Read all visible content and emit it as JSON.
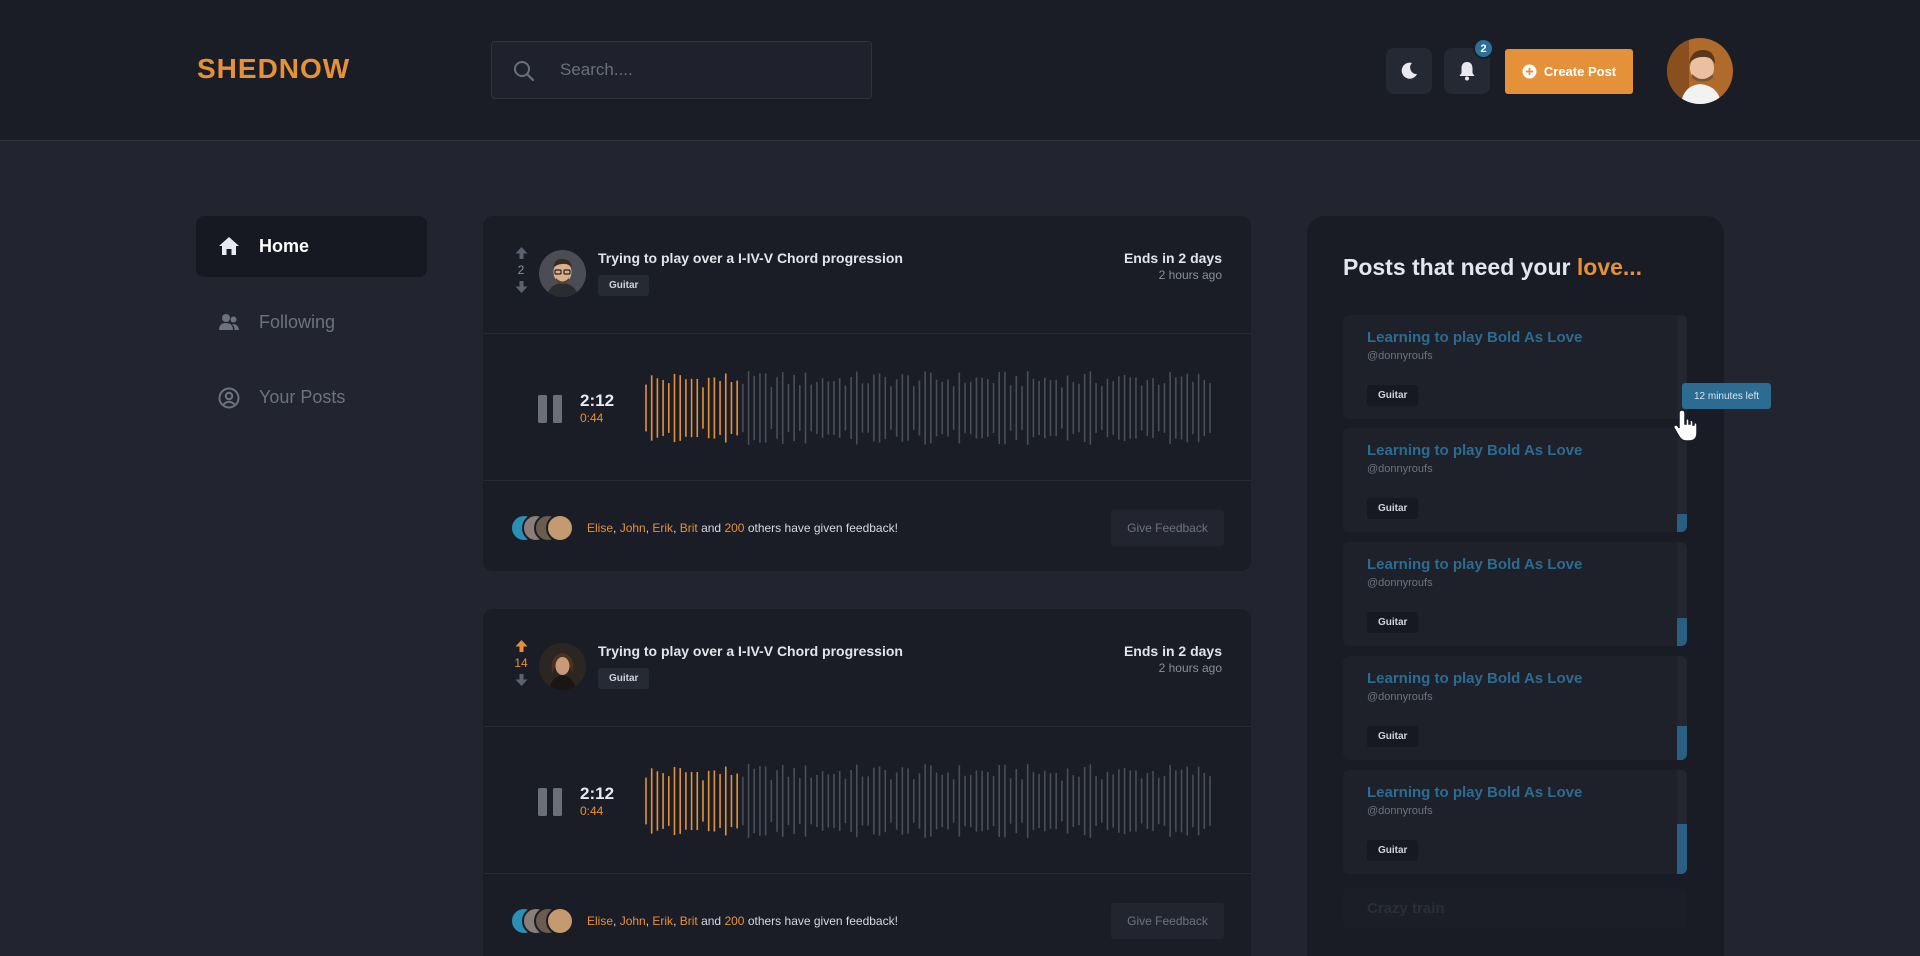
{
  "header": {
    "logo": "SHEDNOW",
    "search_placeholder": "Search....",
    "notification_count": "2",
    "create_post_label": "Create Post"
  },
  "nav": [
    {
      "label": "Home",
      "icon": "home-icon",
      "active": true
    },
    {
      "label": "Following",
      "icon": "users-icon",
      "active": false
    },
    {
      "label": "Your Posts",
      "icon": "user-circle-icon",
      "active": false
    }
  ],
  "posts": [
    {
      "votes": "2",
      "title": "Trying to play over a I-IV-V Chord progression",
      "tag": "Guitar",
      "ends": "Ends in 2 days",
      "ago": "2 hours ago",
      "time_total": "2:12",
      "time_current": "0:44",
      "progress": 0.17,
      "feedback": {
        "names": [
          "Elise",
          "John",
          "Erik",
          "Brit"
        ],
        "and": "and",
        "count": "200",
        "suffix": "others have given feedback!"
      },
      "give_feedback_label": "Give Feedback"
    },
    {
      "votes": "14",
      "title": "Trying to play over a I-IV-V Chord progression",
      "tag": "Guitar",
      "ends": "Ends in 2 days",
      "ago": "2 hours ago",
      "time_total": "2:12",
      "time_current": "0:44",
      "progress": 0.17,
      "feedback": {
        "names": [
          "Elise",
          "John",
          "Erik",
          "Brit"
        ],
        "and": "and",
        "count": "200",
        "suffix": "others have given feedback!"
      },
      "give_feedback_label": "Give Feedback"
    }
  ],
  "panel": {
    "title_prefix": "Posts that need your",
    "title_highlight": "love...",
    "items": [
      {
        "title": "Learning to play Bold As Love",
        "user": "@donnyroufs",
        "tag": "Guitar",
        "level": 0.0
      },
      {
        "title": "Learning to play Bold As Love",
        "user": "@donnyroufs",
        "tag": "Guitar",
        "level": 0.17
      },
      {
        "title": "Learning to play Bold As Love",
        "user": "@donnyroufs",
        "tag": "Guitar",
        "level": 0.27
      },
      {
        "title": "Learning to play Bold As Love",
        "user": "@donnyroufs",
        "tag": "Guitar",
        "level": 0.33
      },
      {
        "title": "Learning to play Bold As Love",
        "user": "@donnyroufs",
        "tag": "Guitar",
        "level": 0.48
      }
    ],
    "faded_item": "Crazy train",
    "tooltip": "12 minutes left"
  },
  "colors": {
    "accent": "#e5913a",
    "link_blue": "#2c6b92",
    "background": "#22252f",
    "card": "#1a1d26"
  }
}
